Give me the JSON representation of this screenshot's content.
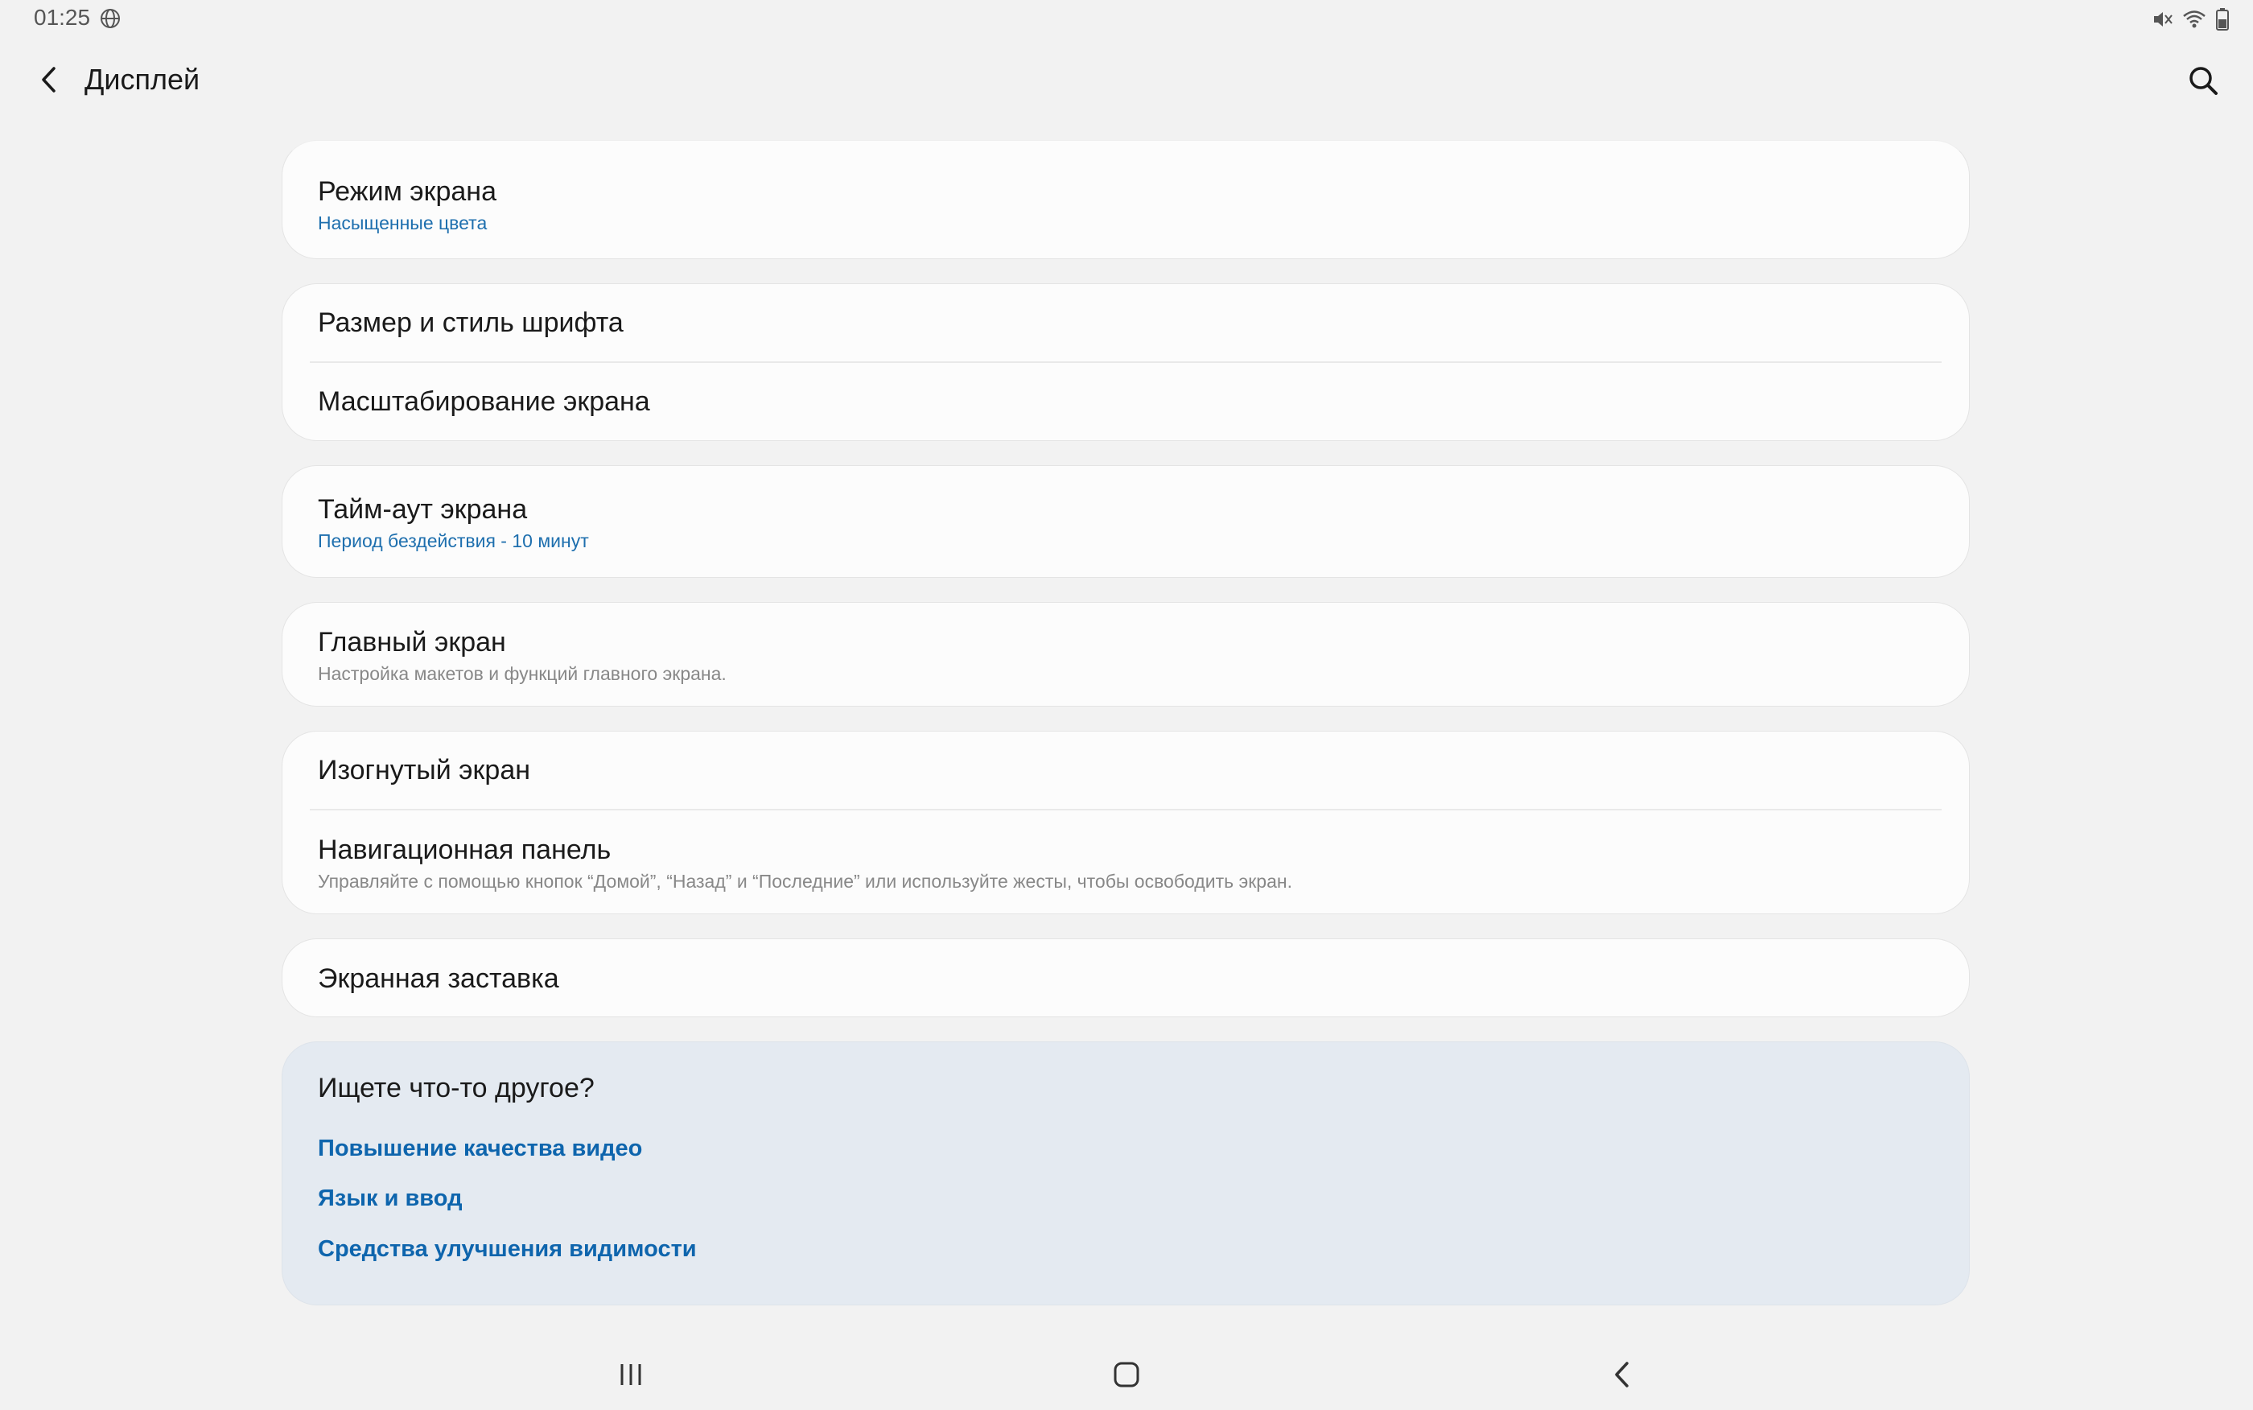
{
  "status": {
    "time": "01:25"
  },
  "header": {
    "title": "Дисплей"
  },
  "cards": [
    {
      "items": [
        {
          "title": "Режим экрана",
          "subtitle": "Насыщенные цвета"
        }
      ]
    },
    {
      "items": [
        {
          "title": "Размер и стиль шрифта"
        },
        {
          "title": "Масштабирование экрана"
        }
      ]
    },
    {
      "items": [
        {
          "title": "Тайм-аут экрана",
          "subtitle": "Период бездействия - 10 минут"
        }
      ]
    },
    {
      "items": [
        {
          "title": "Главный экран",
          "subtitle": "Настройка макетов и функций главного экрана."
        }
      ]
    },
    {
      "items": [
        {
          "title": "Изогнутый экран"
        },
        {
          "title": "Навигационная панель",
          "subtitle": "Управляйте с помощью кнопок “Домой”, “Назад” и “Последние” или используйте жесты, чтобы освободить экран."
        }
      ]
    },
    {
      "items": [
        {
          "title": "Экранная заставка"
        }
      ]
    }
  ],
  "suggestions": {
    "title": "Ищете что-то другое?",
    "links": [
      "Повышение качества видео",
      "Язык и ввод",
      "Средства улучшения видимости"
    ]
  },
  "colors": {
    "accent_subtitle": "#1e6fae",
    "link": "#0e65ad",
    "background": "#f2f2f2"
  }
}
